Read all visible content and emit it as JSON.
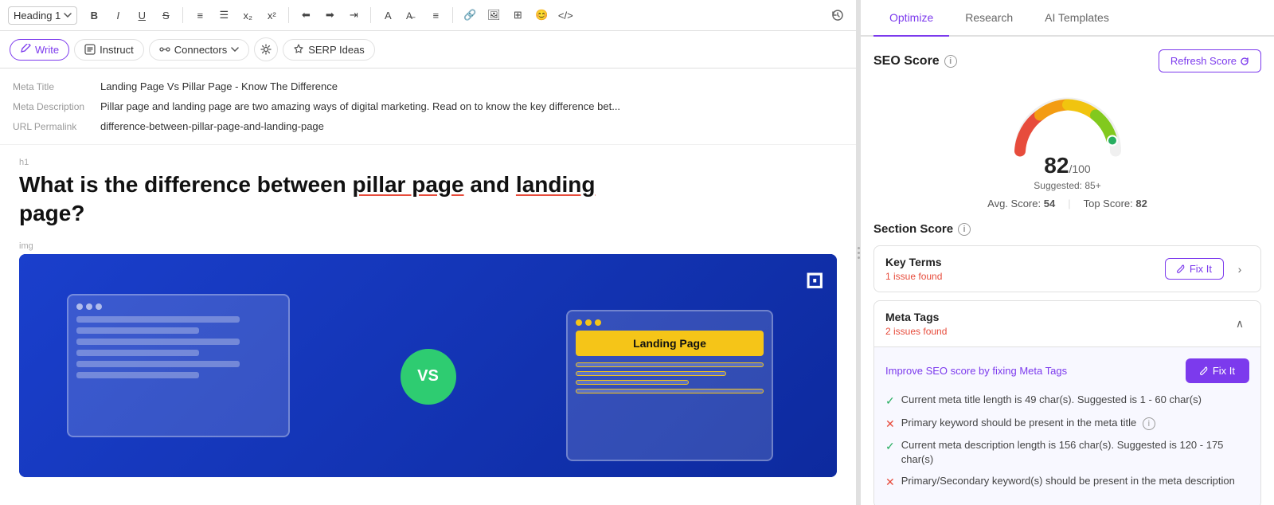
{
  "toolbar": {
    "heading_select": "Heading 1",
    "history_title": "History"
  },
  "sub_toolbar": {
    "write_label": "Write",
    "instruct_label": "Instruct",
    "connectors_label": "Connectors",
    "serp_ideas_label": "SERP Ideas"
  },
  "meta": {
    "title_label": "Meta Title",
    "title_value": "Landing Page Vs Pillar Page - Know The Difference",
    "description_label": "Meta Description",
    "description_value": "Pillar page and landing page are two amazing ways of digital marketing. Read on to know the key difference bet...",
    "url_label": "URL Permalink",
    "url_value": "difference-between-pillar-page-and-landing-page"
  },
  "content": {
    "h1_label": "h1",
    "article_title": "What is the difference between pillar page and landing page?",
    "img_label": "img",
    "landing_page_text": "Landing Page",
    "vs_text": "VS"
  },
  "right_panel": {
    "tabs": [
      {
        "label": "Optimize",
        "active": true
      },
      {
        "label": "Research",
        "active": false
      },
      {
        "label": "AI Templates",
        "active": false
      }
    ],
    "seo_score": {
      "title": "SEO Score",
      "refresh_label": "Refresh Score",
      "score": "82",
      "score_total": "/100",
      "suggested": "Suggested: 85+",
      "avg_score_label": "Avg. Score:",
      "avg_score_value": "54",
      "top_score_label": "Top Score:",
      "top_score_value": "82"
    },
    "section_score": {
      "title": "Section Score"
    },
    "key_terms": {
      "name": "Key Terms",
      "issues": "1 issue found",
      "fix_it_label": "Fix It"
    },
    "meta_tags": {
      "name": "Meta Tags",
      "issues": "2 issues found",
      "fix_it_label": "Fix It",
      "improve_text": "Improve SEO score by fixing Meta Tags",
      "checks": [
        {
          "type": "check",
          "text": "Current meta title length is 49 char(s). Suggested is 1 - 60 char(s)"
        },
        {
          "type": "cross",
          "text": "Primary keyword should be present in the meta title"
        },
        {
          "type": "check",
          "text": "Current meta description length is 156 char(s). Suggested is 120 - 175 char(s)"
        },
        {
          "type": "cross",
          "text": "Primary/Secondary keyword(s) should be present in the meta description"
        }
      ]
    }
  }
}
